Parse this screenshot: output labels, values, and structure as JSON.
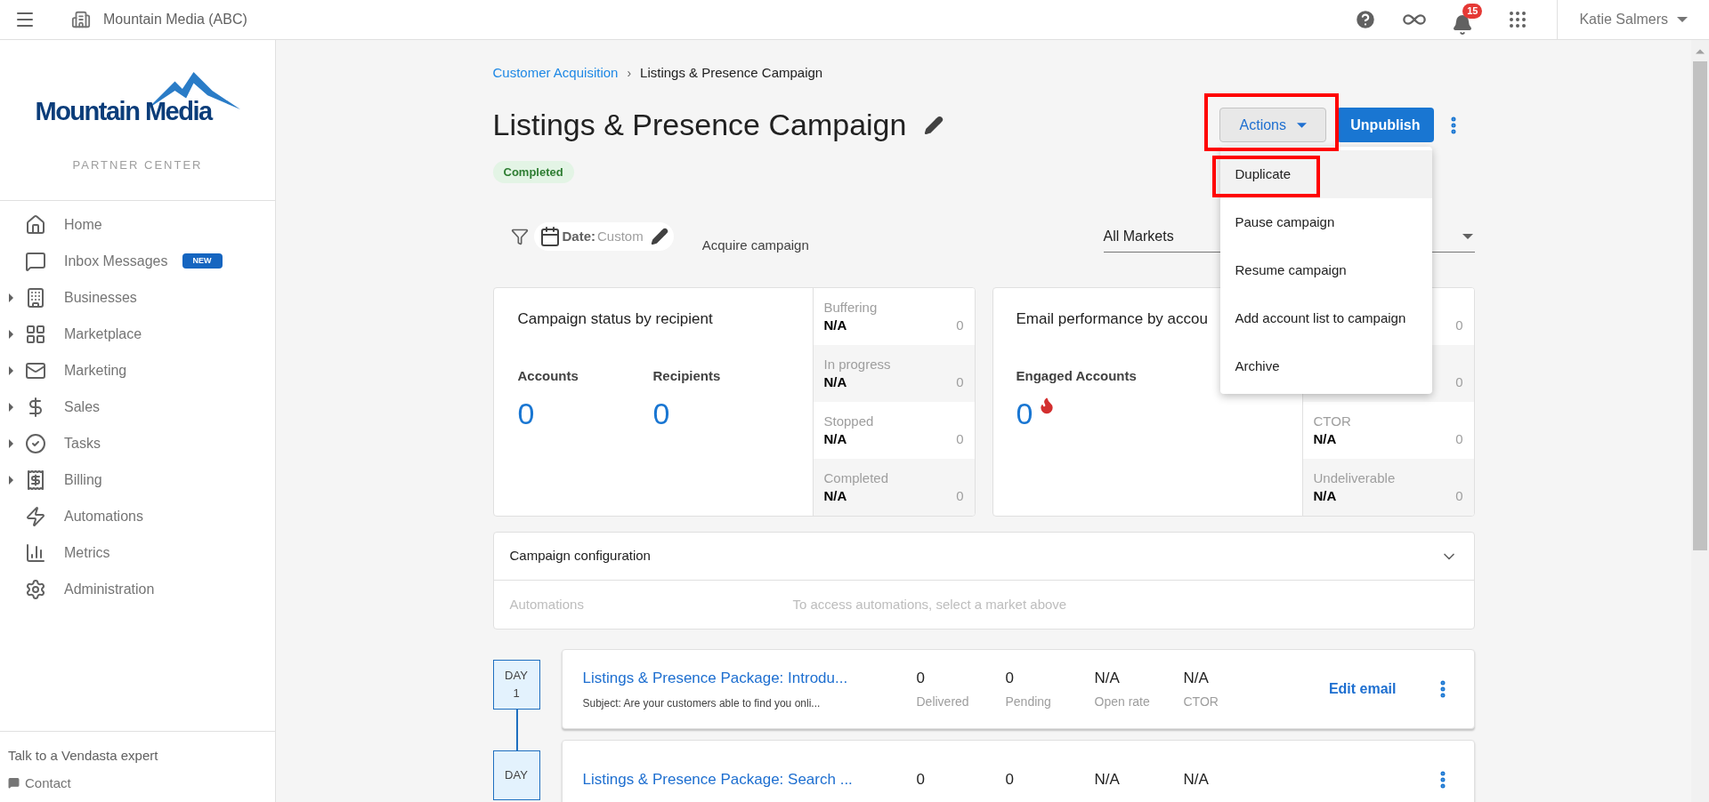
{
  "topbar": {
    "org": "Mountain Media (ABC)",
    "notifications": "15",
    "user": "Katie Salmers"
  },
  "sidebar": {
    "logo_text": "Mountain Media",
    "subtitle": "PARTNER CENTER",
    "items": [
      {
        "label": "Home",
        "expandable": false
      },
      {
        "label": "Inbox Messages",
        "expandable": false,
        "badge": "NEW"
      },
      {
        "label": "Businesses",
        "expandable": true
      },
      {
        "label": "Marketplace",
        "expandable": true
      },
      {
        "label": "Marketing",
        "expandable": true
      },
      {
        "label": "Sales",
        "expandable": true
      },
      {
        "label": "Tasks",
        "expandable": true
      },
      {
        "label": "Billing",
        "expandable": true
      },
      {
        "label": "Automations",
        "expandable": false
      },
      {
        "label": "Metrics",
        "expandable": false
      },
      {
        "label": "Administration",
        "expandable": false
      }
    ],
    "footer": {
      "title": "Talk to a Vendasta expert",
      "contact": "Contact"
    }
  },
  "breadcrumb": {
    "parent": "Customer Acquisition",
    "separator": "›",
    "current": "Listings & Presence Campaign"
  },
  "title": "Listings & Presence Campaign",
  "status": "Completed",
  "actions": {
    "label": "Actions",
    "expanded": true,
    "menu": [
      {
        "label": "Duplicate",
        "highlighted": true
      },
      {
        "label": "Pause campaign",
        "highlighted": false
      },
      {
        "label": "Resume campaign",
        "highlighted": false
      },
      {
        "label": "Add account list to campaign",
        "highlighted": false
      },
      {
        "label": "Archive",
        "highlighted": false
      }
    ]
  },
  "primary_button": "Unpublish",
  "filters": {
    "date_label": "Date:",
    "date_value": "Custom",
    "campaign_type": "Acquire campaign",
    "market": "All Markets"
  },
  "status_card": {
    "title": "Campaign status by recipient",
    "metrics": [
      {
        "label": "Accounts",
        "value": "0"
      },
      {
        "label": "Recipients",
        "value": "0"
      }
    ],
    "stats": [
      {
        "label": "Buffering",
        "value": "N/A",
        "count": "0"
      },
      {
        "label": "In progress",
        "value": "N/A",
        "count": "0"
      },
      {
        "label": "Stopped",
        "value": "N/A",
        "count": "0"
      },
      {
        "label": "Completed",
        "value": "N/A",
        "count": "0"
      }
    ]
  },
  "performance_card": {
    "title": "Email performance by accou",
    "metrics": [
      {
        "label": "Engaged Accounts",
        "value": "0"
      }
    ],
    "stats": [
      {
        "count": "0"
      },
      {
        "count": "0"
      },
      {
        "label": "CTOR",
        "value": "N/A",
        "count": "0"
      },
      {
        "label": "Undeliverable",
        "value": "N/A",
        "count": "0"
      }
    ]
  },
  "config": {
    "title": "Campaign configuration",
    "rows": [
      {
        "label": "Automations",
        "value": "To access automations, select a market above"
      }
    ]
  },
  "emails": [
    {
      "day_label": "DAY",
      "day": "1",
      "title": "Listings & Presence Package: Introdu...",
      "subject": "Subject: Are your customers able to find you onli...",
      "stats": [
        {
          "value": "0",
          "label": "Delivered"
        },
        {
          "value": "0",
          "label": "Pending"
        },
        {
          "value": "N/A",
          "label": "Open rate"
        },
        {
          "value": "N/A",
          "label": "CTOR"
        }
      ],
      "action": "Edit email"
    },
    {
      "day_label": "DAY",
      "title": "Listings & Presence Package: Search ...",
      "stats": [
        {
          "value": "0"
        },
        {
          "value": "0"
        },
        {
          "value": "N/A"
        },
        {
          "value": "N/A"
        }
      ]
    }
  ]
}
